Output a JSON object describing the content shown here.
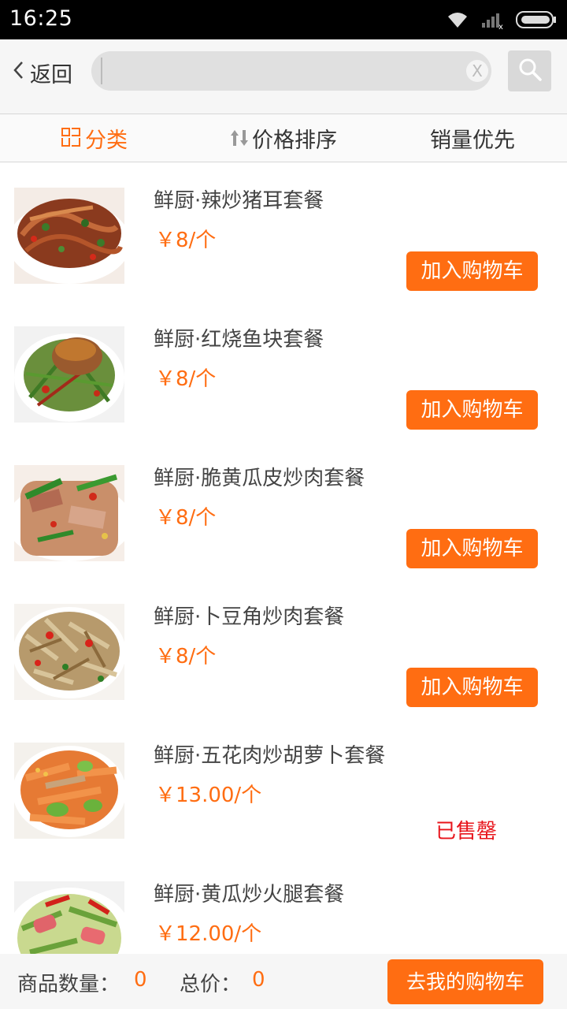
{
  "status_bar": {
    "time": "16:25"
  },
  "header": {
    "back_label": "返回",
    "search": {
      "value": "",
      "placeholder": "",
      "clear_label": "X"
    }
  },
  "filters": [
    {
      "label": "分类",
      "active": true
    },
    {
      "label": "价格排序",
      "active": false
    },
    {
      "label": "销量优先",
      "active": false
    }
  ],
  "products": [
    {
      "name": "鲜厨·辣炒猪耳套餐",
      "price": "￥8/个",
      "action_label": "加入购物车",
      "sold_out": false
    },
    {
      "name": "鲜厨·红烧鱼块套餐",
      "price": "￥8/个",
      "action_label": "加入购物车",
      "sold_out": false
    },
    {
      "name": "鲜厨·脆黄瓜皮炒肉套餐",
      "price": "￥8/个",
      "action_label": "加入购物车",
      "sold_out": false
    },
    {
      "name": "鲜厨·卜豆角炒肉套餐",
      "price": "￥8/个",
      "action_label": "加入购物车",
      "sold_out": false
    },
    {
      "name": "鲜厨·五花肉炒胡萝卜套餐",
      "price": "￥13.00/个",
      "status_label": "已售罄",
      "sold_out": true
    },
    {
      "name": "鲜厨·黄瓜炒火腿套餐",
      "price": "￥12.00/个",
      "sold_out": false
    }
  ],
  "bottom_bar": {
    "quantity_label": "商品数量：",
    "quantity_value": "0",
    "total_label": "总价：",
    "total_value": "0",
    "cart_button_label": "去我的购物车"
  },
  "colors": {
    "accent": "#ff6d12",
    "sold_out": "#e8141b",
    "header_bg": "#f6f6f6"
  }
}
